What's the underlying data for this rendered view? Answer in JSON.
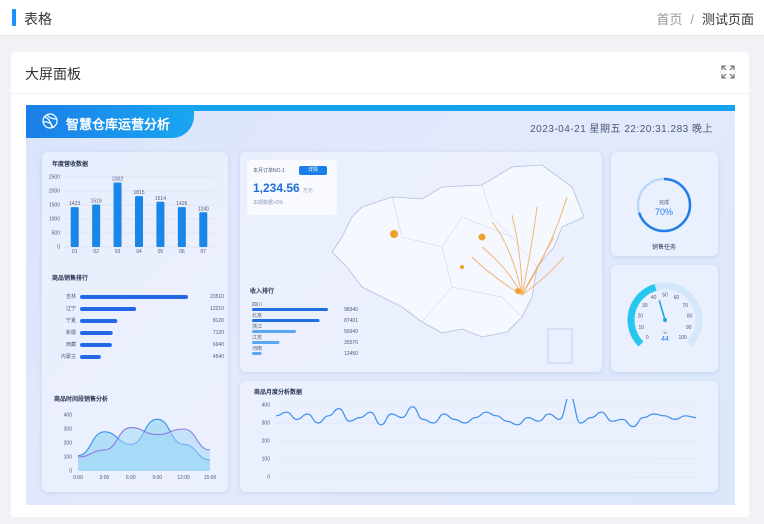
{
  "header": {
    "title": "表格"
  },
  "breadcrumb": {
    "home": "首页",
    "sep": "/",
    "current": "测试页面"
  },
  "card": {
    "title": "大屏面板"
  },
  "dashboard": {
    "title": "智慧仓库运营分析",
    "datetime": "2023-04-21 星期五 22:20:31.283 晚上",
    "annual": {
      "title": "年度营收数据"
    },
    "ranking": {
      "title": "商品销售排行"
    },
    "period": {
      "title": "商品时间段销售分析"
    },
    "order": {
      "label": "本月订单NO.1",
      "button": "详情",
      "value": "1,234.56",
      "unit": "万元",
      "sub": "本期数据+8%"
    },
    "income": {
      "title": "收入排行"
    },
    "task": {
      "ring_label": "完成",
      "ring_value": "70%",
      "title": "销售任务"
    },
    "gauge": {
      "value": "44",
      "unit": "%"
    },
    "monthly": {
      "title": "商品月度分析数据"
    }
  },
  "chart_data": [
    {
      "type": "bar",
      "title": "年度营收数据",
      "categories": [
        "01",
        "02",
        "03",
        "04",
        "05",
        "06",
        "07"
      ],
      "values": [
        1423,
        1519,
        2302,
        1815,
        1614,
        1426,
        1240
      ],
      "ylim": [
        0,
        2500
      ],
      "yticks": [
        "2500",
        "2000",
        "1500",
        "1000",
        "500",
        "0"
      ]
    },
    {
      "type": "bar",
      "title": "商品销售排行",
      "orientation": "horizontal",
      "categories": [
        "吉林",
        "辽宁",
        "宁夏",
        "新疆",
        "西藏",
        "内蒙古"
      ],
      "values": [
        23510,
        12210,
        8120,
        7120,
        6940,
        4540
      ]
    },
    {
      "type": "area",
      "title": "商品时间段销售分析",
      "x": [
        "0:00",
        "3:00",
        "6:00",
        "9:00",
        "12:00",
        "15:00"
      ],
      "yticks": [
        "0",
        "100",
        "200",
        "300",
        "400"
      ],
      "ylim": [
        0,
        400
      ],
      "series": [
        {
          "values": [
            110,
            280,
            190,
            370,
            190,
            80
          ]
        },
        {
          "values": [
            100,
            150,
            310,
            260,
            300,
            150
          ]
        }
      ]
    },
    {
      "type": "bar",
      "title": "收入排行",
      "orientation": "horizontal",
      "categories": [
        "四川",
        "北京",
        "浙江",
        "江苏",
        "河南"
      ],
      "values": [
        98340,
        87401,
        56940,
        35570,
        12450
      ]
    },
    {
      "type": "line",
      "title": "商品月度分析数据",
      "yticks": [
        "400",
        "300",
        "200",
        "100",
        "0"
      ],
      "ylim": [
        0,
        400
      ],
      "values": [
        340,
        360,
        320,
        350,
        300,
        340,
        380,
        310,
        330,
        360,
        290,
        350,
        330,
        390,
        320,
        300,
        350,
        320,
        300,
        330,
        360,
        340,
        310,
        290,
        330,
        310,
        350,
        320,
        450,
        300,
        330,
        360,
        310,
        320,
        280,
        330,
        350,
        340,
        320,
        340,
        330
      ]
    }
  ],
  "colors": {
    "accent": "#1890ff",
    "bar": "#1a86e8",
    "line": "#3d8ff0",
    "area_fill": "#9bd6f5",
    "purple": "#8a7be0"
  }
}
